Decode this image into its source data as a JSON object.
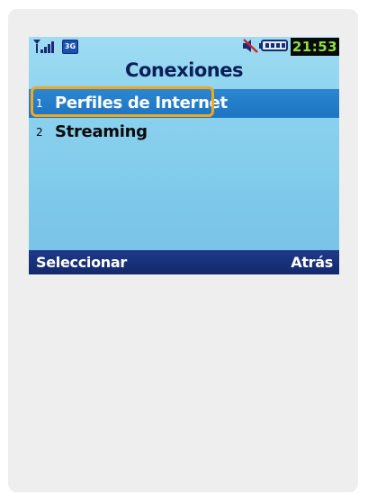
{
  "status": {
    "signal_icon": "signal-strength-icon",
    "network": "3G",
    "mute_icon": "muted-speaker-icon",
    "battery_icon": "battery-icon",
    "battery_level": 1.0,
    "time": "21:53"
  },
  "screen": {
    "title": "Conexiones",
    "items": [
      {
        "number": "1",
        "label": "Perfiles de Internet",
        "selected": true
      },
      {
        "number": "2",
        "label": "Streaming",
        "selected": false
      }
    ]
  },
  "softkeys": {
    "left": "Seleccionar",
    "right": "Atrás"
  },
  "colors": {
    "highlight_border": "#f2a81d",
    "selection": "#1d74c3",
    "softkey_bar": "#1e3a8a",
    "clock_text": "#8ee040"
  }
}
